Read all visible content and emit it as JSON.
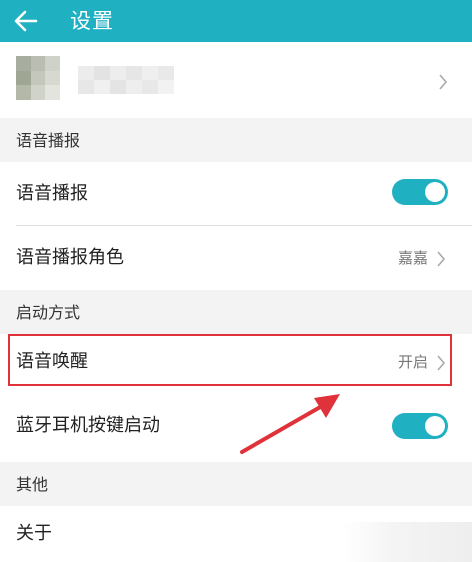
{
  "appbar": {
    "title": "设置"
  },
  "sections": {
    "voice_broadcast": {
      "header": "语音播报"
    },
    "launch_mode": {
      "header": "启动方式"
    },
    "other": {
      "header": "其他"
    }
  },
  "rows": {
    "voice_broadcast": {
      "label": "语音播报",
      "enabled": true
    },
    "voice_role": {
      "label": "语音播报角色",
      "value": "嘉嘉"
    },
    "voice_wakeup": {
      "label": "语音唤醒",
      "value": "开启"
    },
    "bluetooth_launch": {
      "label": "蓝牙耳机按键启动",
      "enabled": true
    },
    "about": {
      "label": "关于"
    }
  },
  "colors": {
    "accent": "#1fb0c2",
    "highlight": "#e0323a"
  }
}
